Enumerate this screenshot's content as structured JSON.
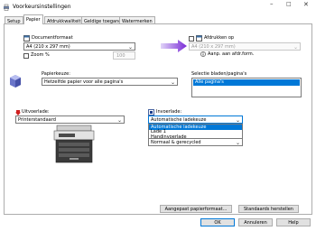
{
  "window": {
    "title": "Voorkeursinstellingen"
  },
  "tabs": [
    {
      "label": "Setup"
    },
    {
      "label": "Papier"
    },
    {
      "label": "Afdrukkwaliteit"
    },
    {
      "label": "Geldige toegang"
    },
    {
      "label": "Watermerken"
    }
  ],
  "document_size": {
    "label": "Documentformaat",
    "value": "A4 (210 x 297 mm)",
    "zoom_label": "Zoom %",
    "zoom_value": "100"
  },
  "fit_to": {
    "label": "Afdrukken op",
    "value": "A4 (210 x 297 mm)",
    "hint": "Aanp. aan afdr.form."
  },
  "paper_selection": {
    "label": "Papierkeuze:",
    "value": "Hetzelfde papier voor alle pagina's"
  },
  "page_selection": {
    "label": "Selectie bladen/pagina's",
    "items": [
      "Alle pagina's"
    ]
  },
  "output_tray": {
    "label": "Uitvoerlade:",
    "value": "Printerstandaard"
  },
  "paper_source": {
    "label": "Invoerlade:",
    "value": "Automatische ladekeuze",
    "options": [
      "Automatische ladekeuze",
      "Lade 1",
      "Handinvoerlade"
    ],
    "paper_type_value": "Normaal & gerecycled"
  },
  "buttons": {
    "custom_paper": "Aangepast papierformaat...",
    "defaults": "Standaards herstellen",
    "ok": "OK",
    "cancel": "Annuleren",
    "help": "Help"
  },
  "colors": {
    "accent": "#0078d7",
    "arrow": "#7a2bd6",
    "tray_icon": "#d02020"
  }
}
